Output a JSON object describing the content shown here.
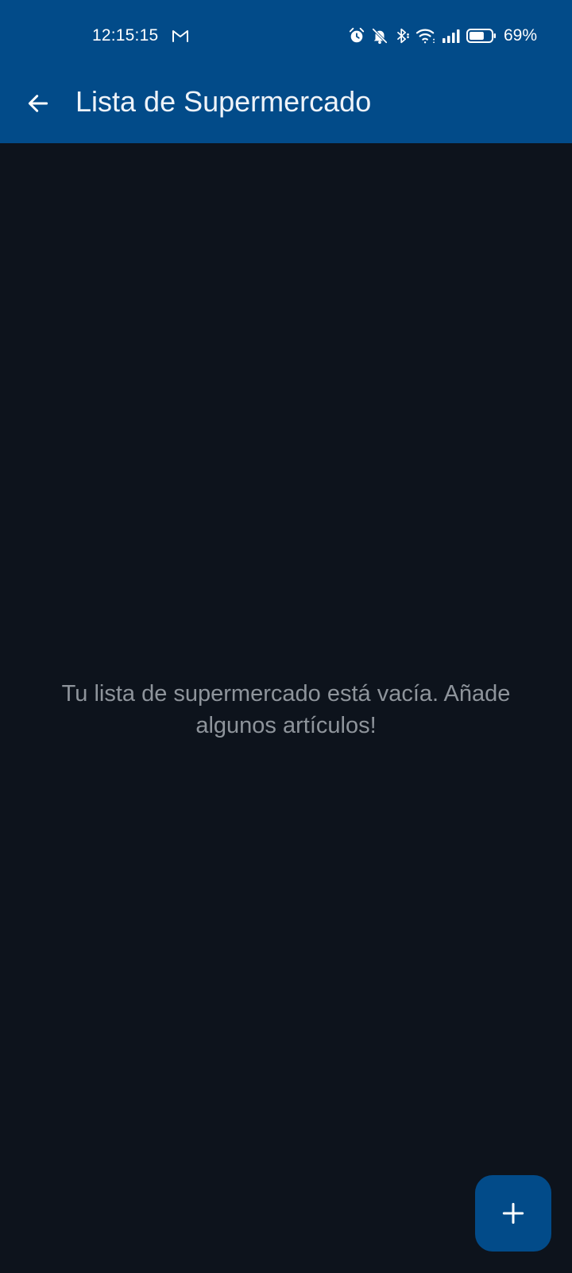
{
  "status_bar": {
    "time": "12:15:15",
    "notification_icons": [
      "gmail-icon"
    ],
    "system_icons": [
      "alarm-icon",
      "bell-off-icon",
      "bluetooth-icon",
      "wifi-icon",
      "signal-icon",
      "battery-icon"
    ],
    "battery_percent": "69%",
    "battery_level": 0.69
  },
  "app_bar": {
    "back_icon": "arrow-back-icon",
    "title": "Lista de Supermercado"
  },
  "content": {
    "empty_message": "Tu lista de supermercado está vacía. Añade algunos artículos!"
  },
  "fab": {
    "icon": "plus-icon"
  },
  "colors": {
    "primary": "#024b89",
    "background": "#0d131c",
    "on_primary": "#ffffff",
    "empty_text": "#8e949b"
  }
}
